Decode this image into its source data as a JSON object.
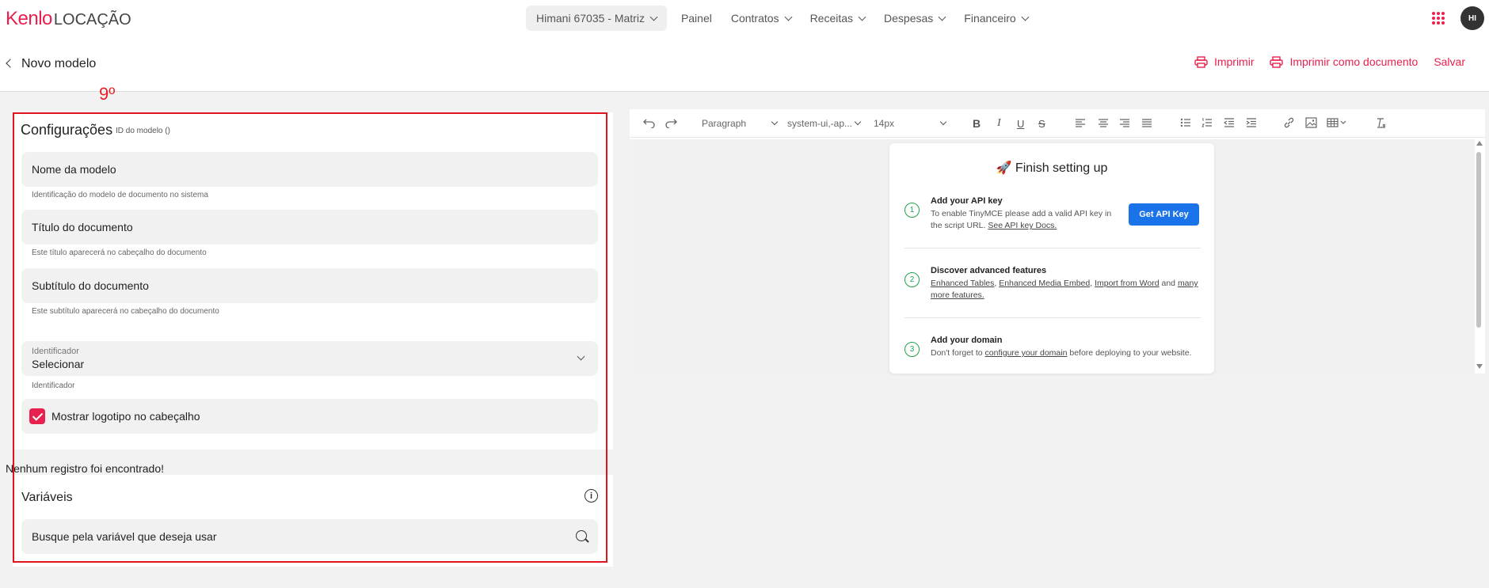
{
  "header": {
    "logo_brand": "Kenlo",
    "logo_product": "LOCAÇÃO",
    "account": "Himani 67035 - Matriz",
    "nav": [
      {
        "label": "Painel"
      },
      {
        "label": "Contratos"
      },
      {
        "label": "Receitas"
      },
      {
        "label": "Despesas"
      },
      {
        "label": "Financeiro"
      }
    ],
    "avatar": "HI"
  },
  "subheader": {
    "title": "Novo modelo",
    "actions": {
      "print": "Imprimir",
      "print_document": "Imprimir como documento",
      "save": "Salvar"
    }
  },
  "annotation": {
    "label": "9º"
  },
  "config": {
    "title": "Configurações",
    "model_id": "ID do modelo ()",
    "name_field": {
      "placeholder": "Nome da modelo",
      "hint": "Identificação do modelo de documento no sistema"
    },
    "title_field": {
      "placeholder": "Título do documento",
      "hint": "Este título aparecerá no cabeçalho do documento"
    },
    "subtitle_field": {
      "placeholder": "Subtítulo do documento",
      "hint": "Este subtítulo aparecerá no cabeçalho do documento"
    },
    "identifier": {
      "label": "Identificador",
      "value": "Selecionar",
      "hint": "Identificador"
    },
    "show_logo": {
      "label": "Mostrar logotipo no cabeçalho",
      "checked": true
    }
  },
  "empty_message": "Nenhum registro foi encontrado!",
  "variables": {
    "title": "Variáveis",
    "search_placeholder": "Busque pela variável que deseja usar"
  },
  "editor": {
    "toolbar": {
      "block": "Paragraph",
      "font": "system-ui,-ap...",
      "size": "14px"
    },
    "setup": {
      "title": "🚀 Finish setting up",
      "steps": [
        {
          "num": "1",
          "title": "Add your API key",
          "text_1": "To enable TinyMCE please add a valid API key in",
          "text_2": "the script URL.",
          "link": "See API key Docs."
        },
        {
          "num": "2",
          "title": "Discover advanced features",
          "link_1": "Enhanced Tables",
          "link_2": "Enhanced Media Embed",
          "link_3": "Import from Word",
          "and": "and",
          "link_4a": "many",
          "link_4b": "more features."
        },
        {
          "num": "3",
          "title": "Add your domain",
          "text_1": "Don't forget to",
          "link": "configure your domain",
          "text_2": "before deploying to your website."
        }
      ],
      "api_button": "Get API Key"
    }
  },
  "colors": {
    "brand": "#e8204d",
    "annotation": "#e0141e",
    "api_button": "#1a73e8",
    "step": "#1fa44a"
  }
}
